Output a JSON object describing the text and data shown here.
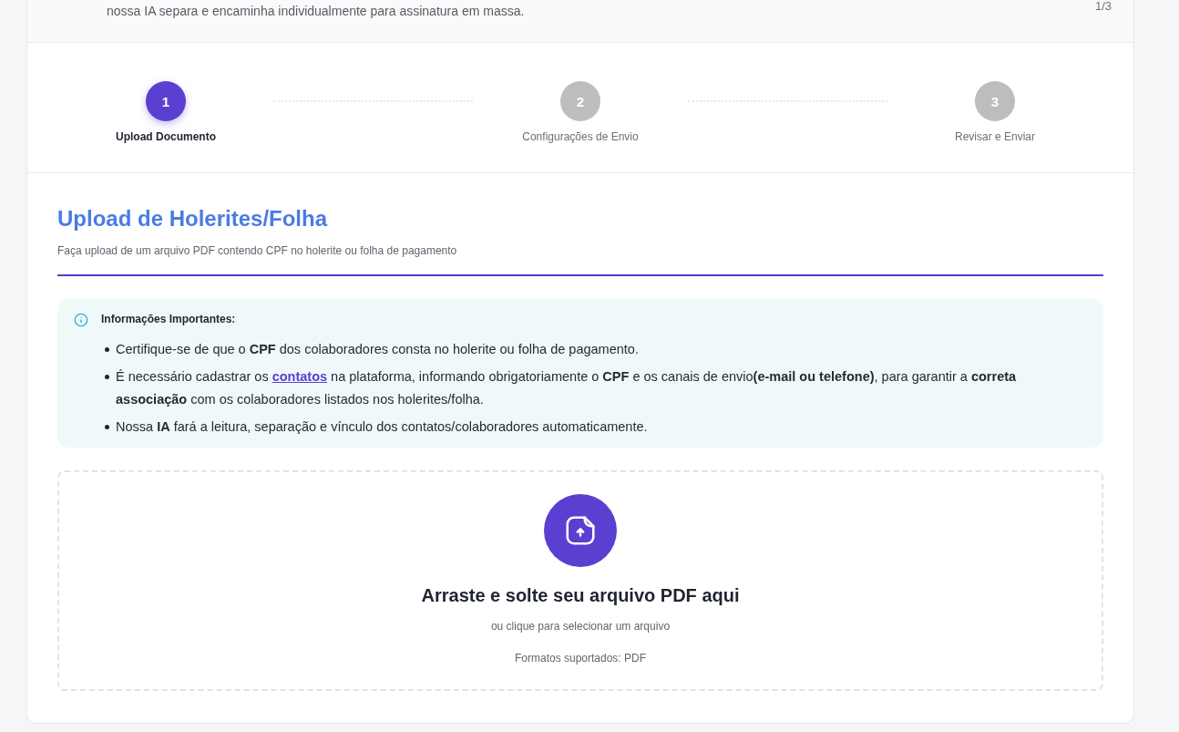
{
  "header": {
    "description": "nossa IA separa e encaminha individualmente para assinatura em massa.",
    "step_counter": "1/3"
  },
  "steps": [
    {
      "number": "1",
      "label": "Upload Documento",
      "selected": true
    },
    {
      "number": "2",
      "label": "Configurações de Envio",
      "selected": false
    },
    {
      "number": "3",
      "label": "Revisar e Enviar",
      "selected": false
    }
  ],
  "section": {
    "title": "Upload de Holerites/Folha",
    "subtitle": "Faça upload de um arquivo PDF contendo CPF no holerite ou folha de pagamento"
  },
  "info": {
    "title": "Informações Importantes:",
    "items": [
      {
        "segments": [
          {
            "kind": "text",
            "text": "Certifique-se de que o **CPF** dos colaboradores consta no holerite ou folha de pagamento."
          }
        ]
      },
      {
        "segments": [
          {
            "kind": "text",
            "text": "É necessário cadastrar os "
          },
          {
            "kind": "link",
            "text": "contatos"
          },
          {
            "kind": "text",
            "text": " na plataforma, informando obrigatoriamente o **CPF** e os canais de envio**(e-mail ou telefone)**, para garantir a **correta associação** com os colaboradores listados nos holerites/folha."
          }
        ]
      },
      {
        "segments": [
          {
            "kind": "text",
            "text": "Nossa **IA** fará a leitura, separação e vínculo dos contatos/colaboradores automaticamente."
          }
        ]
      }
    ]
  },
  "dropzone": {
    "title": "Arraste e solte seu arquivo PDF aqui",
    "hint": "ou clique para selecionar um arquivo",
    "formats": "Formatos suportados: PDF"
  }
}
